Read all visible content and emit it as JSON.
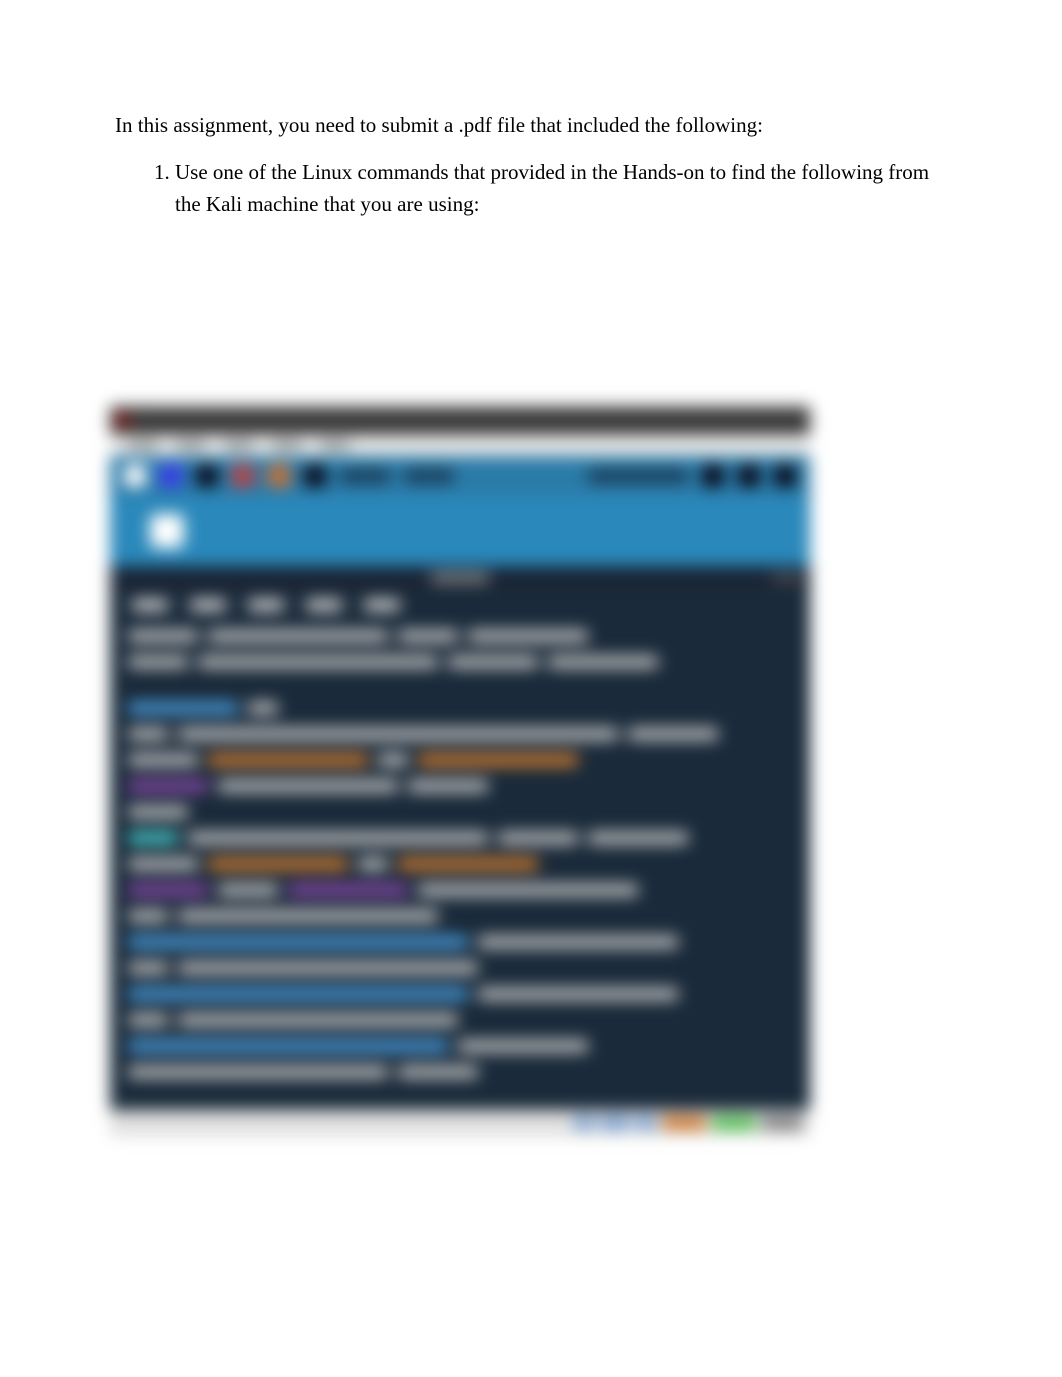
{
  "document": {
    "intro": "In this assignment, you need to submit a .pdf file that included the following:",
    "items": [
      {
        "text": "Use one of the Linux commands that provided in the Hands-on to find the following from the Kali machine that you are using:"
      }
    ]
  },
  "screenshot": {
    "description": "Blurred Kali Linux desktop screenshot showing a terminal window with network interface command output",
    "window": {
      "titlebar_present": true,
      "menubar_items": [
        "File",
        "Actions",
        "Edit",
        "View",
        "Help"
      ]
    },
    "taskbar_bottom": {
      "items": [
        "panel-icon",
        "panel-icon",
        "panel-icon",
        "orange-item",
        "green-item",
        "gray-item"
      ]
    }
  }
}
